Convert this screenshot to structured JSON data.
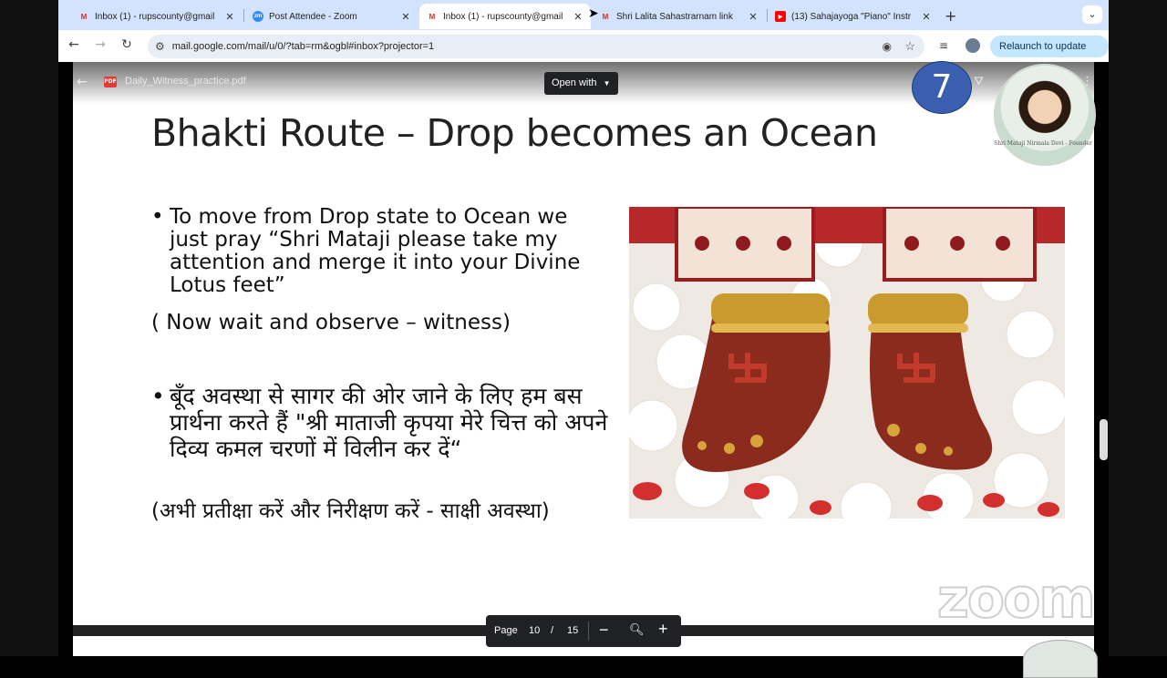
{
  "browser": {
    "tabs": [
      {
        "title": "Inbox (1) - rupscounty@gmail",
        "favicon": "gmail-icon",
        "active": false
      },
      {
        "title": "Post Attendee - Zoom",
        "favicon": "zoom-icon",
        "active": false
      },
      {
        "title": "Inbox (1) - rupscounty@gmail",
        "favicon": "gmail-icon",
        "active": true
      },
      {
        "title": "Shri Lalita Sahastrarnam link",
        "favicon": "gmail-icon",
        "active": false
      },
      {
        "title": "(13) Sahajayoga \"Piano\" Instr",
        "favicon": "youtube-icon",
        "active": false
      }
    ],
    "url": "mail.google.com/mail/u/0/?tab=rm&ogbl#inbox?projector=1",
    "relaunch_label": "Relaunch to update"
  },
  "viewer": {
    "file_name": "Daily_Witness_practice.pdf",
    "open_with_label": "Open with",
    "participant_number": "7",
    "portrait_caption": "Shri Mataji Nirmala Devi - Founder",
    "page_label": "Page",
    "current_page": "10",
    "page_separator": "/",
    "total_pages": "15"
  },
  "slide": {
    "title": "Bhakti Route – Drop becomes an Ocean",
    "bullet1": "To move from Drop state to Ocean we just pray “Shri Mataji please take my attention and merge it into your Divine Lotus feet”",
    "note1": "( Now wait and observe – witness)",
    "bullet2": "बूँद अवस्था से सागर की ओर जाने के लिए हम बस प्रार्थना करते हैं \"श्री माताजी कृपया मेरे चित्त को अपने दिव्य कमल चरणों में विलीन कर दें“",
    "note2": "(अभी प्रतीक्षा करें और निरीक्षण करें - साक्षी अवस्था)",
    "bullet_glyph": "•"
  },
  "overlay": {
    "watermark": "zoom"
  },
  "colors": {
    "tabstrip": "#d3e3fd",
    "participant_bubble": "#3a5fb0",
    "relaunch_pill": "#c2e7ff"
  }
}
